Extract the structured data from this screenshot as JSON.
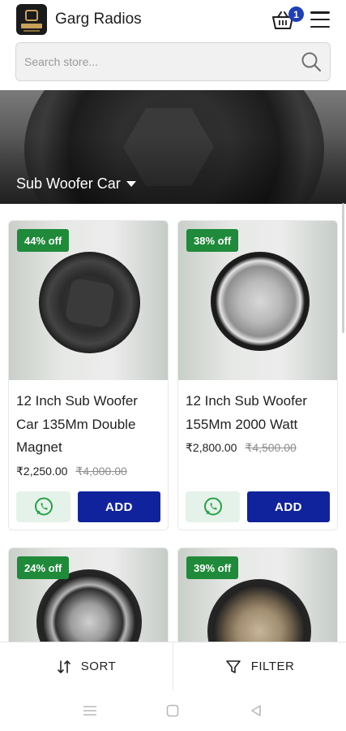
{
  "header": {
    "brand": "Garg Radios",
    "cart_count": "1",
    "icons": {
      "cart": "basket-icon",
      "menu": "hamburger-icon",
      "logo": "brand-logo"
    }
  },
  "search": {
    "placeholder": "Search store..."
  },
  "banner": {
    "category": "Sub Woofer Car"
  },
  "products": [
    {
      "discount": "44% off",
      "title": "12 Inch Sub Woofer Car 135Mm Double Magnet",
      "price": "₹2,250.00",
      "mrp": "₹4,000.00",
      "add_label": "ADD"
    },
    {
      "discount": "38% off",
      "title": "12 Inch Sub Woofer 155Mm 2000 Watt",
      "price": "₹2,800.00",
      "mrp": "₹4,500.00",
      "add_label": "ADD"
    },
    {
      "discount": "24% off"
    },
    {
      "discount": "39% off"
    }
  ],
  "bottom_bar": {
    "sort_label": "SORT",
    "filter_label": "FILTER"
  },
  "colors": {
    "accent": "#10239d",
    "badge": "#1f8a3a",
    "cart_badge": "#1f3fb6",
    "whatsapp": "#25a244"
  }
}
